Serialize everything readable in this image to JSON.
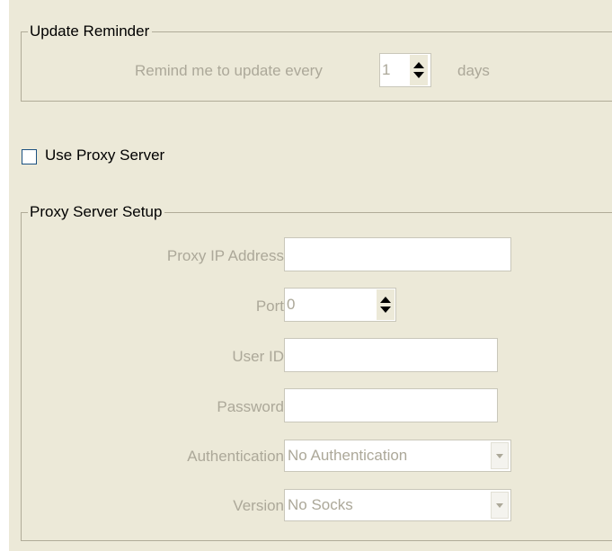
{
  "update_reminder": {
    "group_title": "Update Reminder",
    "remind_label": "Remind me to update every",
    "interval_value": "1",
    "unit_label": "days"
  },
  "proxy": {
    "use_proxy_label": "Use Proxy Server",
    "use_proxy_checked": false
  },
  "proxy_setup": {
    "group_title": "Proxy Server Setup",
    "ip_label": "Proxy IP Address",
    "ip_value": "",
    "port_label": "Port",
    "port_value": "0",
    "user_label": "User ID",
    "user_value": "",
    "password_label": "Password",
    "password_value": "",
    "auth_label": "Authentication",
    "auth_value": "No Authentication",
    "version_label": "Version",
    "version_value": "No Socks"
  }
}
